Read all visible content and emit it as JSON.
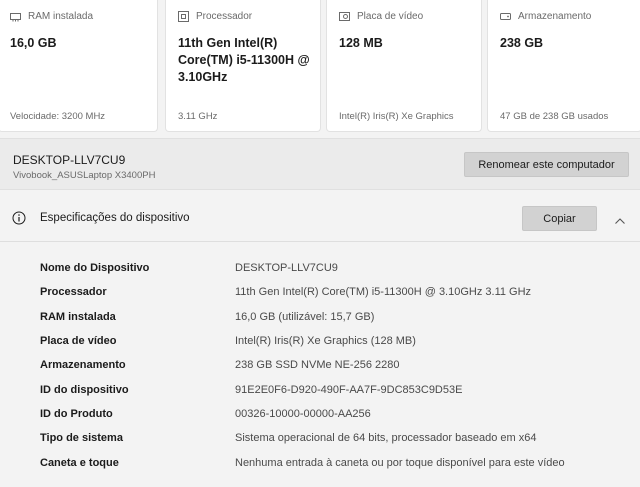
{
  "cards": [
    {
      "icon": "memory-icon",
      "label": "RAM instalada",
      "value": "16,0 GB",
      "footer": "Velocidade: 3200 MHz"
    },
    {
      "icon": "processor-icon",
      "label": "Processador",
      "value": "11th Gen Intel(R) Core(TM) i5-11300H @ 3.10GHz",
      "footer": "3.11 GHz"
    },
    {
      "icon": "graphics-card-icon",
      "label": "Placa de vídeo",
      "value": "128 MB",
      "footer": "Intel(R) Iris(R) Xe Graphics"
    },
    {
      "icon": "storage-icon",
      "label": "Armazenamento",
      "value": "238 GB",
      "footer": "47 GB de 238 GB usados"
    }
  ],
  "device": {
    "name": "DESKTOP-LLV7CU9",
    "model": "Vivobook_ASUSLaptop X3400PH",
    "rename_label": "Renomear este computador"
  },
  "specs": {
    "title": "Especificações do dispositivo",
    "copy_label": "Copiar",
    "rows": [
      {
        "key": "Nome do Dispositivo",
        "value": "DESKTOP-LLV7CU9"
      },
      {
        "key": "Processador",
        "value": "11th Gen Intel(R) Core(TM) i5-11300H @ 3.10GHz   3.11 GHz"
      },
      {
        "key": "RAM instalada",
        "value": "16,0 GB (utilizável: 15,7 GB)"
      },
      {
        "key": "Placa de vídeo",
        "value": "Intel(R) Iris(R) Xe Graphics (128 MB)"
      },
      {
        "key": "Armazenamento",
        "value": "238 GB SSD NVMe NE-256 2280"
      },
      {
        "key": "ID do dispositivo",
        "value": "91E2E0F6-D920-490F-AA7F-9DC853C9D53E"
      },
      {
        "key": "ID do Produto",
        "value": "00326-10000-00000-AA256"
      },
      {
        "key": "Tipo de sistema",
        "value": "Sistema operacional de 64 bits, processador baseado em x64"
      },
      {
        "key": "Caneta e toque",
        "value": "Nenhuma entrada à caneta ou por toque disponível para este vídeo"
      }
    ]
  }
}
